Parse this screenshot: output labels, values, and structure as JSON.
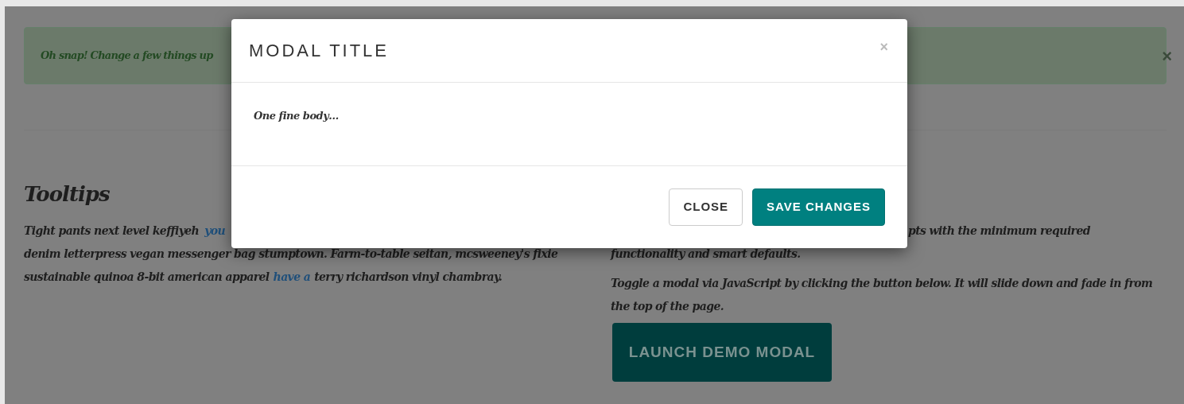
{
  "alert": {
    "text": "Oh snap! Change a few things up",
    "close": "×"
  },
  "tooltips": {
    "heading": "Tooltips",
    "line_1": "Tight pants next level keffiyeh",
    "line_1_link": "you",
    "line_2": "denim letterpress vegan messenger bag stumptown. Farm-to-table seitan, mcsweeney's fixie",
    "line_3_before": "sustainable quinoa 8-bit american apparel",
    "line_3_link": "have a",
    "line_3_after": "terry richardson vinyl chambray."
  },
  "modals_section": {
    "line_1": "pts with the minimum required",
    "line_2": "functionality and smart defaults.",
    "paragraph_2": "Toggle a modal via JavaScript by clicking the button below. It will slide down and fade in from the top of the page.",
    "launch_button": "LAUNCH DEMO MODAL"
  },
  "modal": {
    "title": "MODAL TITLE",
    "close": "×",
    "body": "One fine body…",
    "buttons": [
      {
        "label": "CLOSE",
        "kind": "default"
      },
      {
        "label": "SAVE CHANGES",
        "kind": "primary"
      }
    ]
  }
}
